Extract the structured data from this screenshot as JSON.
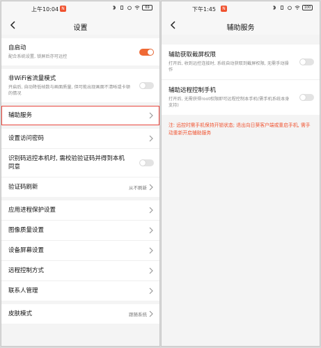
{
  "left": {
    "status_time": "上午10:04",
    "notif_badge": "N",
    "battery": "69",
    "title": "设置",
    "groups": [
      [
        {
          "label": "自启动",
          "desc": "配合系统设置, 锁屏后亦可远控",
          "control": "toggle-on"
        }
      ],
      [
        {
          "label": "非WiFi省流量模式",
          "desc": "开启后, 自动降低帧数与画面质量, 但可能出现画面不清晰或卡顿的情况",
          "control": "toggle-off"
        }
      ],
      [
        {
          "label": "辅助服务",
          "control": "chevron",
          "highlight": true
        }
      ],
      [
        {
          "label": "设置访问密码",
          "control": "chevron"
        },
        {
          "label": "识别码远控本机时, 需校验验证码并得到本机同意",
          "control": "toggle-off"
        },
        {
          "label": "验证码刷新",
          "value": "从不刷新",
          "control": "chevron"
        }
      ],
      [
        {
          "label": "应用进程保护设置",
          "control": "chevron"
        },
        {
          "label": "图像质量设置",
          "control": "chevron"
        },
        {
          "label": "设备屏幕设置",
          "control": "chevron"
        },
        {
          "label": "远程控制方式",
          "control": "chevron"
        },
        {
          "label": "联系人管理",
          "control": "chevron"
        }
      ],
      [
        {
          "label": "皮肤模式",
          "value": "跟随系统",
          "control": "chevron"
        }
      ]
    ]
  },
  "right": {
    "status_time": "下午1:45",
    "notif_badge": "N",
    "battery": "100",
    "title": "辅助服务",
    "items": [
      {
        "label": "辅助获取截屏权限",
        "desc": "打开后, 收到远控连接时, 系统自动获取到截屏权限, 无需手动操作",
        "control": "toggle-off"
      },
      {
        "label": "辅助远程控制手机",
        "desc": "打开后, 无需获得root权限即可远程控制本手机(需手机系统本身支持)",
        "control": "toggle-off"
      }
    ],
    "note": "注: 远控时需手机保持开锁状态; 退出向日葵客户端或重启手机, 需手动重新开启辅助服务"
  }
}
